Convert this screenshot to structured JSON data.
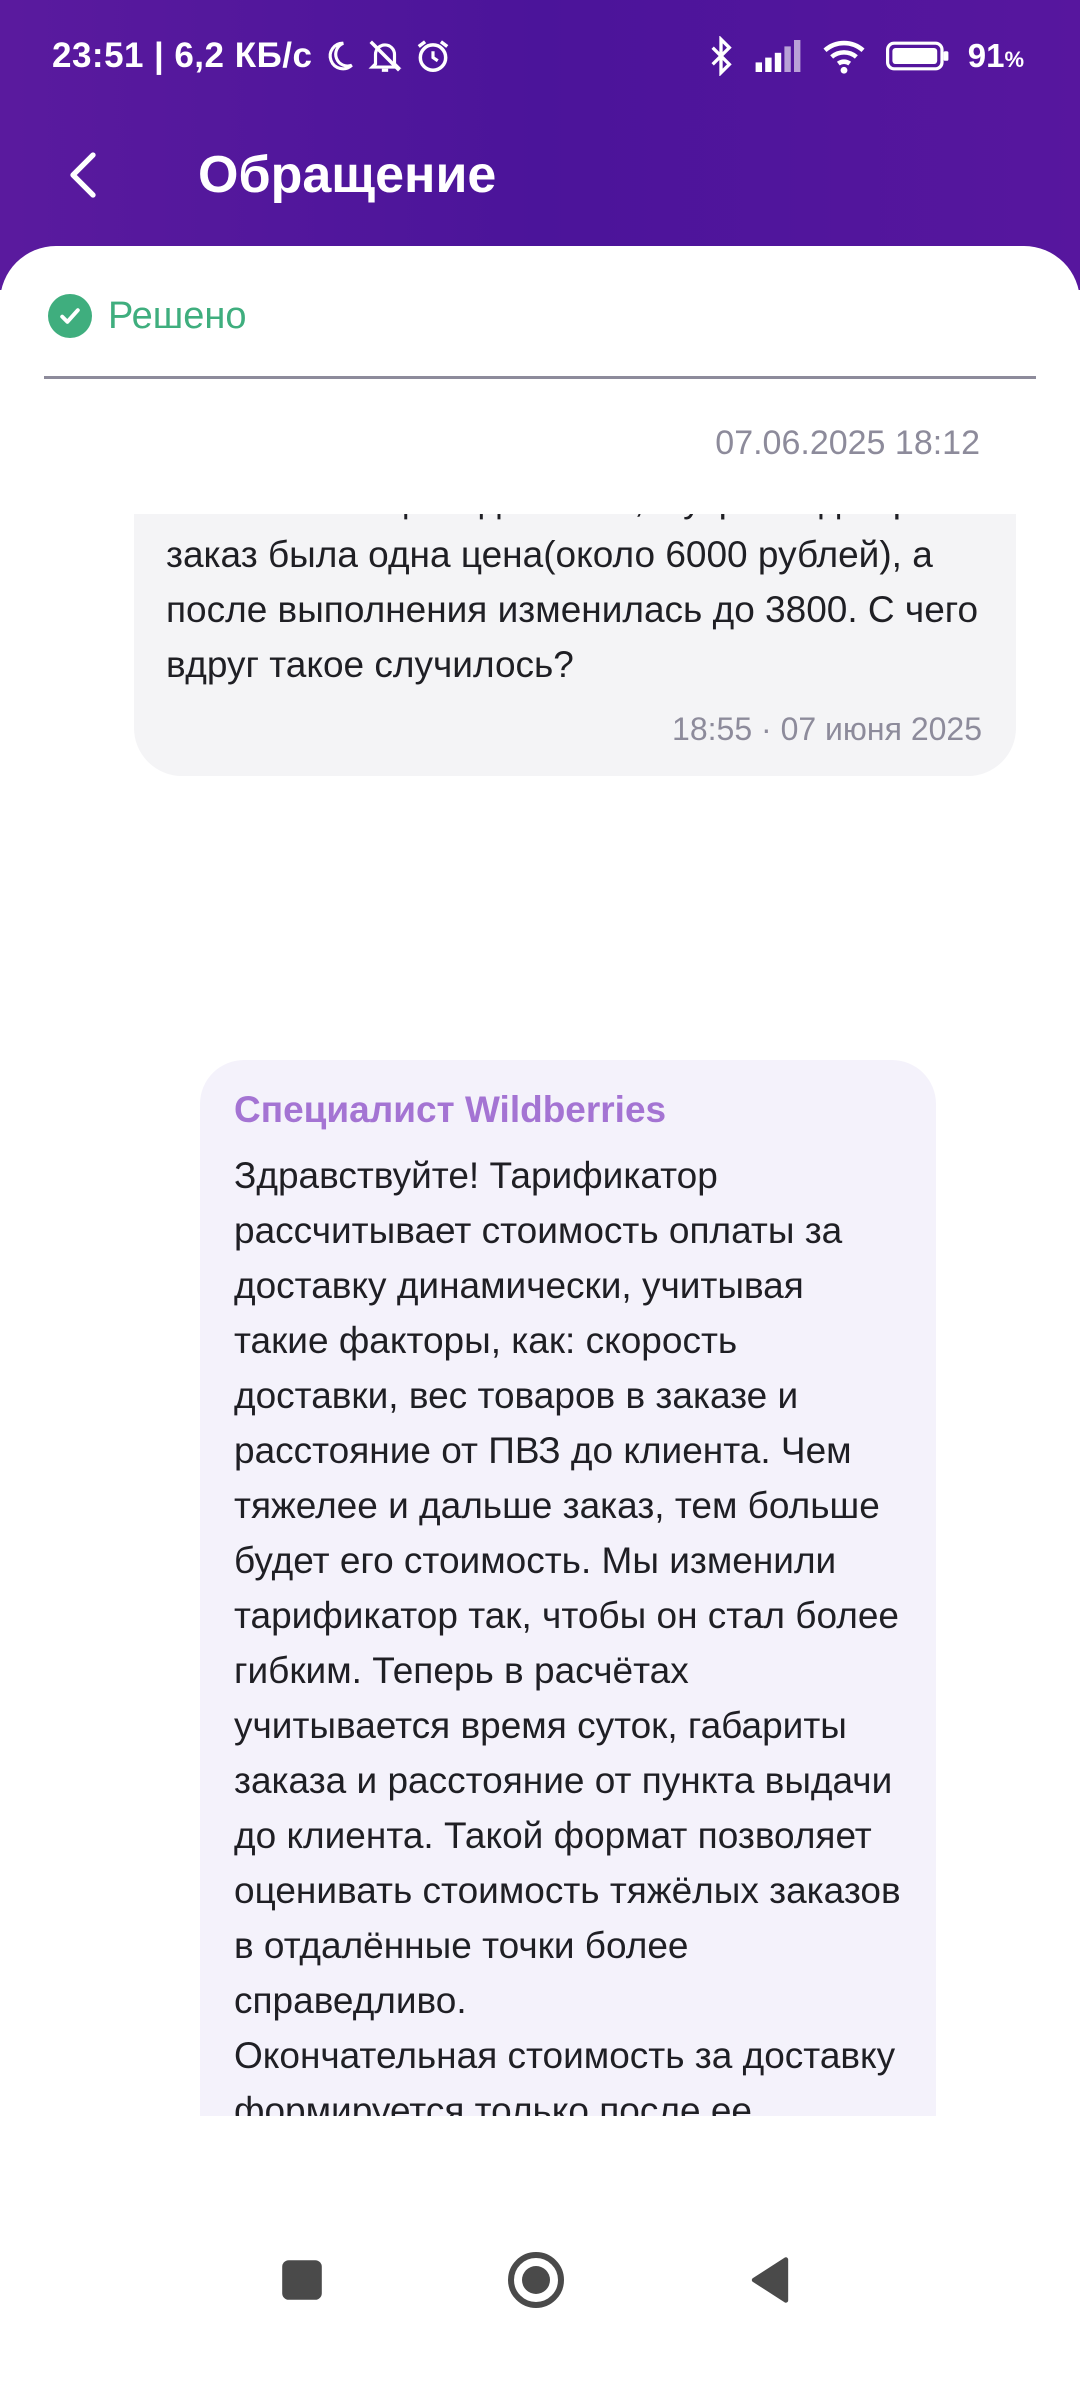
{
  "status_bar": {
    "time": "23:51",
    "separator": "|",
    "network_speed": "6,2 КБ/с",
    "battery_percent": "91",
    "battery_symbol": "%",
    "icons": [
      "moon-icon",
      "muted-bell-icon",
      "alarm-icon",
      "bluetooth-icon",
      "signal-icon",
      "wifi-icon",
      "battery-icon"
    ]
  },
  "header": {
    "title": "Обращение",
    "back_icon": "chevron-left-icon"
  },
  "ticket": {
    "status": "Решено",
    "status_icon": "check-circle-icon",
    "status_color": "#3fae7e",
    "date": "07.06.2025 18:12"
  },
  "messages": [
    {
      "author": "user",
      "text": "Изменилась цена доставки, с утра когда брал заказ была одна цена(около 6000 рублей), а после выполнения изменилась до 3800. С чего вдруг такое случилось?",
      "time": "18:55 · 07 июня 2025"
    },
    {
      "author": "Специалист Wildberries",
      "text": "Здравствуйте! Тарификатор рассчитывает стоимость оплаты за доставку динамически, учитывая такие факторы, как: скорость доставки, вес товаров в заказе и расстояние от ПВЗ до клиента. Чем тяжелее и дальше заказ, тем больше будет его стоимость. Мы изменили тарификатор так, чтобы он стал более гибким. Теперь в расчётах учитывается время суток, габариты заказа и расстояние от пункта выдачи до клиента. Такой формат позволяет оценивать стоимость тяжёлых заказов в отдалённые точки более справедливо.\nОкончательная стоимость за доставку формируется только после ее завершения. Спасибо за обращение!"
    }
  ],
  "colors": {
    "header_purple": "#4b149a",
    "author_purple": "#a474d3",
    "user_bubble": "#f4f4f6",
    "support_bubble": "#f4f2fb"
  },
  "nav_bar": {
    "icons": [
      "recents-square-icon",
      "home-circle-icon",
      "back-triangle-icon"
    ]
  }
}
